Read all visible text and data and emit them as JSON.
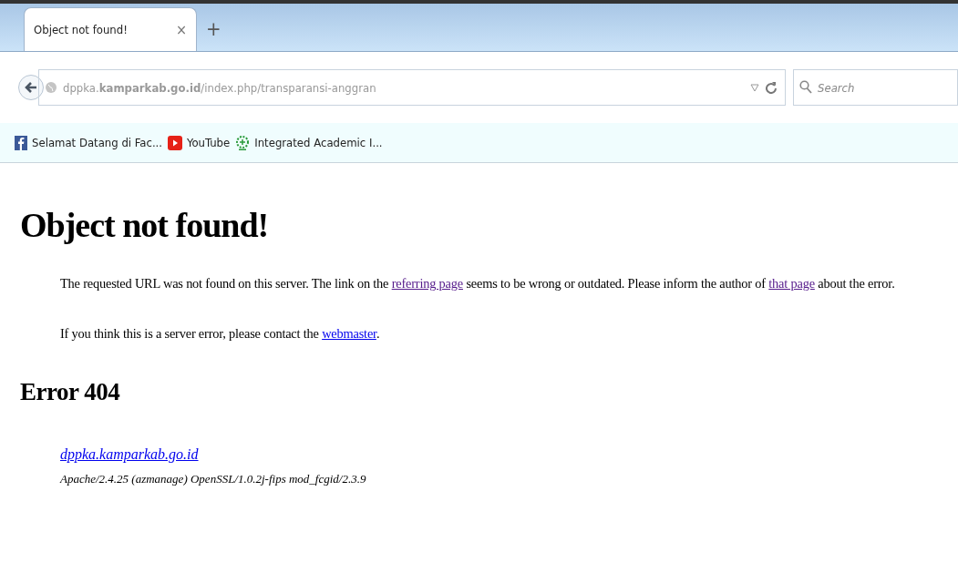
{
  "tabs": [
    {
      "label": "Object not found!",
      "selected": true,
      "close": "×"
    }
  ],
  "new_tab": "+",
  "address_bar": {
    "value": "dppka.**kamparkab.go.id**/index.php/transparansi-anggran"
  },
  "search": {
    "placeholder": "Search"
  },
  "bookmarks": [
    {
      "kind": "facebook",
      "label": "Selamat Datang di Fac..."
    },
    {
      "kind": "youtube",
      "label": "YouTube"
    },
    {
      "kind": "campus",
      "label": "Integrated Academic I..."
    }
  ],
  "page": {
    "heading": "Object not found!",
    "paragraphs": [
      [
        {
          "kind": "text",
          "text": "The requested URL was not found on this server. The link on the "
        },
        {
          "kind": "link",
          "text": "referring page",
          "visited": true
        },
        {
          "kind": "text",
          "text": " seems to be wrong or outdated. Please inform the author of "
        },
        {
          "kind": "link",
          "text": "that page",
          "visited": true
        },
        {
          "kind": "text",
          "text": " about the error."
        }
      ],
      [
        {
          "kind": "text",
          "text": "If you think this is a server error, please contact the "
        },
        {
          "kind": "link",
          "text": "webmaster",
          "visited": false
        },
        {
          "kind": "text",
          "text": "."
        }
      ]
    ],
    "error_heading": "Error 404",
    "server_link": "dppka.kamparkab.go.id",
    "server_signature": "Apache/2.4.25 (azmanage) OpenSSL/1.0.2j-fips mod_fcgid/2.3.9"
  }
}
